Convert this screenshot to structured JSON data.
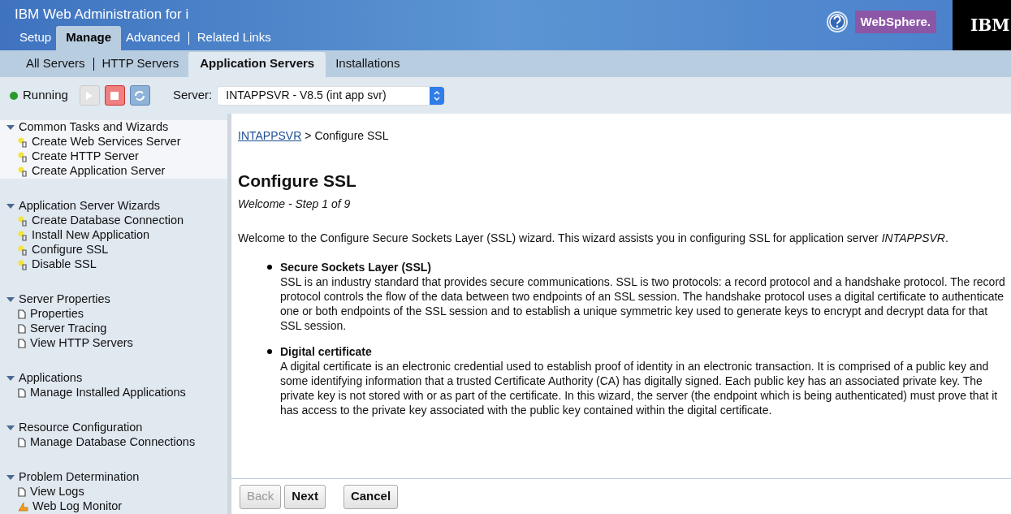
{
  "header": {
    "title": "IBM Web Administration for i",
    "badge": "WebSphere.",
    "logo": "IBM"
  },
  "tabs": [
    {
      "label": "Setup",
      "selected": false
    },
    {
      "label": "Manage",
      "selected": true
    },
    {
      "label": "Advanced",
      "selected": false
    },
    {
      "label": "Related Links",
      "selected": false
    }
  ],
  "subtabs": [
    {
      "label": "All Servers",
      "selected": false
    },
    {
      "label": "HTTP Servers",
      "selected": false
    },
    {
      "label": "Application Servers",
      "selected": true
    },
    {
      "label": "Installations",
      "selected": false
    }
  ],
  "toolbar": {
    "status": "Running",
    "running": true,
    "server_label": "Server:",
    "server_value": "INTAPPSVR - V8.5 (int app svr)",
    "start_disabled": true
  },
  "sidebar": [
    {
      "title": "Common Tasks and Wizards",
      "expanded": true,
      "selected": true,
      "items": [
        {
          "label": "Create Web Services Server",
          "kind": "wizard"
        },
        {
          "label": "Create HTTP Server",
          "kind": "wizard"
        },
        {
          "label": "Create Application Server",
          "kind": "wizard"
        }
      ]
    },
    {
      "title": "Application Server Wizards",
      "expanded": true,
      "selected": false,
      "items": [
        {
          "label": "Create Database Connection",
          "kind": "wizard"
        },
        {
          "label": "Install New Application",
          "kind": "wizard"
        },
        {
          "label": "Configure SSL",
          "kind": "wizard"
        },
        {
          "label": "Disable SSL",
          "kind": "wizard"
        }
      ]
    },
    {
      "title": "Server Properties",
      "expanded": true,
      "selected": false,
      "items": [
        {
          "label": "Properties",
          "kind": "page"
        },
        {
          "label": "Server Tracing",
          "kind": "page"
        },
        {
          "label": "View HTTP Servers",
          "kind": "page"
        }
      ]
    },
    {
      "title": "Applications",
      "expanded": true,
      "selected": false,
      "items": [
        {
          "label": "Manage Installed Applications",
          "kind": "page"
        }
      ]
    },
    {
      "title": "Resource Configuration",
      "expanded": true,
      "selected": false,
      "items": [
        {
          "label": "Manage Database Connections",
          "kind": "page"
        }
      ]
    },
    {
      "title": "Problem Determination",
      "expanded": true,
      "selected": false,
      "items": [
        {
          "label": "View Logs",
          "kind": "page"
        },
        {
          "label": "Web Log Monitor",
          "kind": "monitor"
        }
      ]
    }
  ],
  "content": {
    "breadcrumb_link": "INTAPPSVR",
    "breadcrumb_rest": "> Configure SSL",
    "heading": "Configure SSL",
    "step": "Welcome - Step 1 of 9",
    "intro": "Welcome to the Configure Secure Sockets Layer (SSL) wizard. This wizard assists you in configuring SSL for application server *INTAPPSVR*.",
    "bullets": [
      {
        "title": "Secure Sockets Layer (SSL)",
        "text": "SSL is an industry standard that provides secure communications. SSL is two protocols: a record protocol and a handshake protocol. The record protocol controls the flow of the data between two endpoints of an SSL session. The handshake protocol uses a digital certificate to authenticate one or both endpoints of the SSL session and to establish a unique symmetric key used to generate keys to encrypt and decrypt data for that SSL session."
      },
      {
        "title": "Digital certificate",
        "text": "A digital certificate is an electronic credential used to establish proof of identity in an electronic transaction. It is comprised of a public key and some identifying information that a trusted Certificate Authority (CA) has digitally signed. Each public key has an associated private key. The private key is not stored with or as part of the certificate. In this wizard, the server (the endpoint which is being authenticated) must prove that it has access to the private key associated with the public key contained within the digital certificate."
      }
    ]
  },
  "buttons": [
    {
      "label": "Back",
      "disabled": true
    },
    {
      "label": "Next",
      "disabled": false
    },
    {
      "label": "Cancel",
      "disabled": false
    }
  ]
}
